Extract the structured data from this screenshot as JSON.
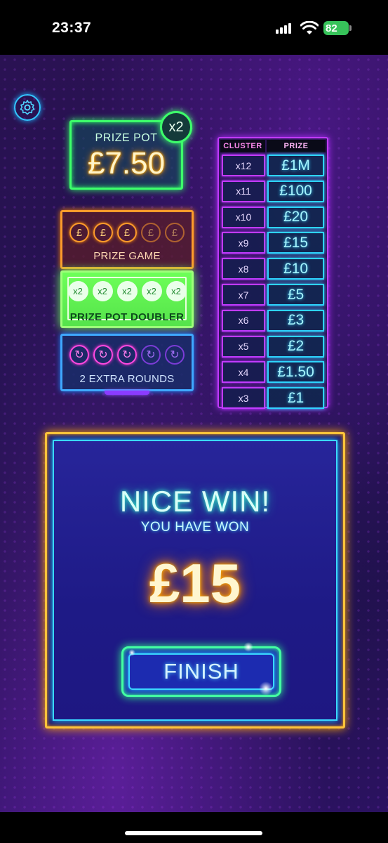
{
  "status_bar": {
    "time": "23:37",
    "battery_level": "82"
  },
  "icons": {
    "settings": "gear-icon",
    "signal": "cellular-signal-icon",
    "wifi": "wifi-icon",
    "battery": "battery-icon"
  },
  "prize_pot": {
    "label": "PRIZE POT",
    "value": "£7.50",
    "multiplier": "x2"
  },
  "prize_game": {
    "coin_symbol": "£",
    "coins_total": 5,
    "coins_lit": 3,
    "label": "PRIZE GAME"
  },
  "prize_pot_doubler": {
    "chips": [
      "x2",
      "x2",
      "x2",
      "x2",
      "x2"
    ],
    "label": "PRIZE POT DOUBLER"
  },
  "extra_rounds": {
    "rounds_total": 5,
    "rounds_lit": 3,
    "label": "2 EXTRA ROUNDS"
  },
  "paytable": {
    "header_cluster": "CLUSTER",
    "header_prize": "PRIZE",
    "rows": [
      {
        "cluster": "x12",
        "prize": "£1M"
      },
      {
        "cluster": "x11",
        "prize": "£100"
      },
      {
        "cluster": "x10",
        "prize": "£20"
      },
      {
        "cluster": "x9",
        "prize": "£15"
      },
      {
        "cluster": "x8",
        "prize": "£10"
      },
      {
        "cluster": "x7",
        "prize": "£5"
      },
      {
        "cluster": "x6",
        "prize": "£3"
      },
      {
        "cluster": "x5",
        "prize": "£2"
      },
      {
        "cluster": "x4",
        "prize": "£1.50"
      },
      {
        "cluster": "x3",
        "prize": "£1"
      }
    ]
  },
  "win_dialog": {
    "title": "NICE WIN!",
    "subtitle": "YOU HAVE WON",
    "amount": "£15",
    "finish_label": "FINISH"
  },
  "colors": {
    "accent_green": "#3dff6b",
    "accent_gold": "#ffc33a",
    "accent_magenta": "#c13bff",
    "accent_cyan": "#2ed4ff"
  }
}
